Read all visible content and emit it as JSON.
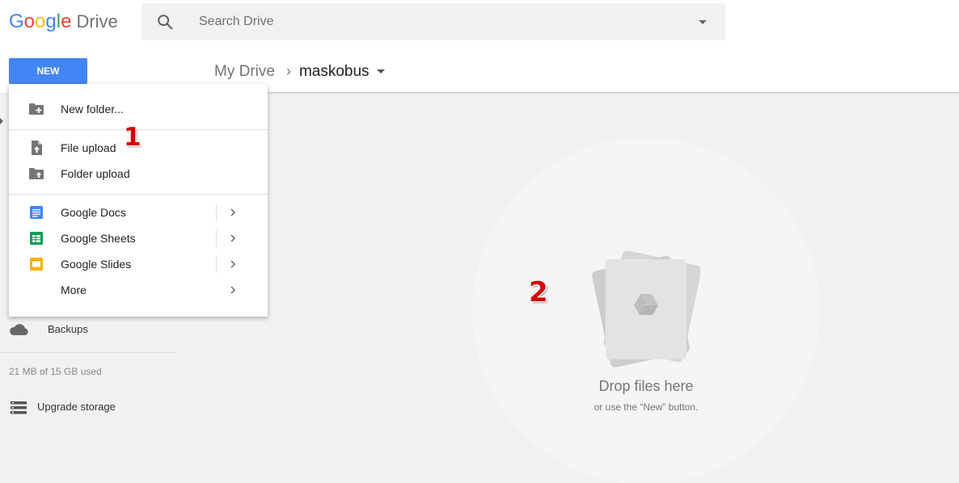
{
  "header": {
    "logo_letters": [
      "G",
      "o",
      "o",
      "g",
      "l",
      "e"
    ],
    "product_name": "Drive",
    "search": {
      "placeholder": "Search Drive",
      "icon": "search-icon"
    }
  },
  "new_button": {
    "label": "NEW"
  },
  "breadcrumb": {
    "root": "My Drive",
    "separator": "›",
    "current": "maskobus"
  },
  "menu": {
    "new_folder": "New folder...",
    "file_upload": "File upload",
    "folder_upload": "Folder upload",
    "google_docs": "Google Docs",
    "google_sheets": "Google Sheets",
    "google_slides": "Google Slides",
    "more": "More"
  },
  "sidebar": {
    "backups": "Backups",
    "storage_used": "21 MB of 15 GB used",
    "upgrade_storage": "Upgrade storage"
  },
  "dropzone": {
    "title": "Drop files here",
    "subtitle": "or use the “New” button."
  },
  "annotations": {
    "one": "1",
    "two": "2"
  },
  "colors": {
    "accent": "#4285f4",
    "docs": "#4285f4",
    "sheets": "#0f9d58",
    "slides": "#f4b400"
  }
}
